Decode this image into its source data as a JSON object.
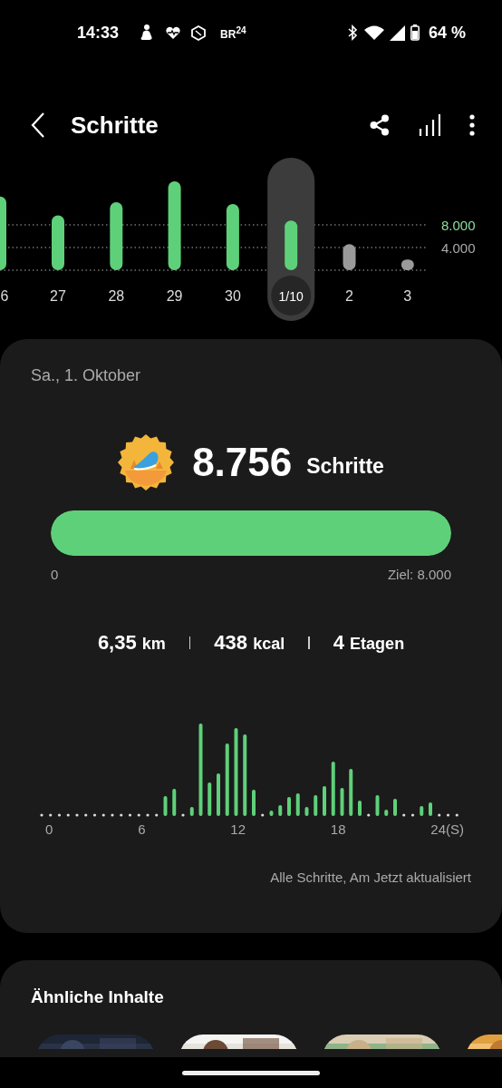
{
  "status_bar": {
    "time": "14:33",
    "notification_logo": "BR$^{24}$",
    "battery": "64 %"
  },
  "header": {
    "title": "Schritte"
  },
  "days": [
    {
      "selected": false
    },
    {
      "selected": false
    },
    {
      "selected": false
    },
    {
      "selected": false
    },
    {
      "selected": false
    },
    {
      "selected": true
    },
    {
      "selected": false
    },
    {
      "selected": false
    }
  ],
  "chart_data": {
    "type": "bar",
    "categories": [
      "6",
      "27",
      "28",
      "29",
      "30",
      "1/10",
      "2",
      "3"
    ],
    "series": [
      {
        "color": "#5fd07a",
        "values": [
          13000,
          9700,
          12000,
          15700,
          11700,
          8756,
          null,
          null
        ]
      },
      {
        "color": "#9a9a9a",
        "values": [
          null,
          null,
          null,
          null,
          null,
          null,
          4600,
          1900
        ]
      }
    ],
    "ylim": [
      0,
      16000
    ],
    "yticks": [
      {
        "value": 4000,
        "label": "4.000"
      },
      {
        "value": 8000,
        "label": "8.000"
      }
    ]
  },
  "summary": {
    "date": "Sa., 1. Oktober",
    "steps": "8.756",
    "steps_unit": "Schritte",
    "progress": {
      "level": 1,
      "start_label": "0",
      "goal_label": "Ziel: 8.000"
    },
    "stats": [
      {
        "value": "6,35",
        "unit": "km"
      },
      {
        "value": "438",
        "unit": "kcal"
      },
      {
        "value": "4",
        "unit": "Etagen"
      }
    ],
    "hourly_chart": {
      "x_labels": [
        "0",
        "6",
        "12",
        "18",
        "24(S)"
      ]
    },
    "footer": "Alle Schritte, Am Jetzt aktualisiert"
  },
  "related": {
    "title": "Ähnliche Inhalte"
  }
}
